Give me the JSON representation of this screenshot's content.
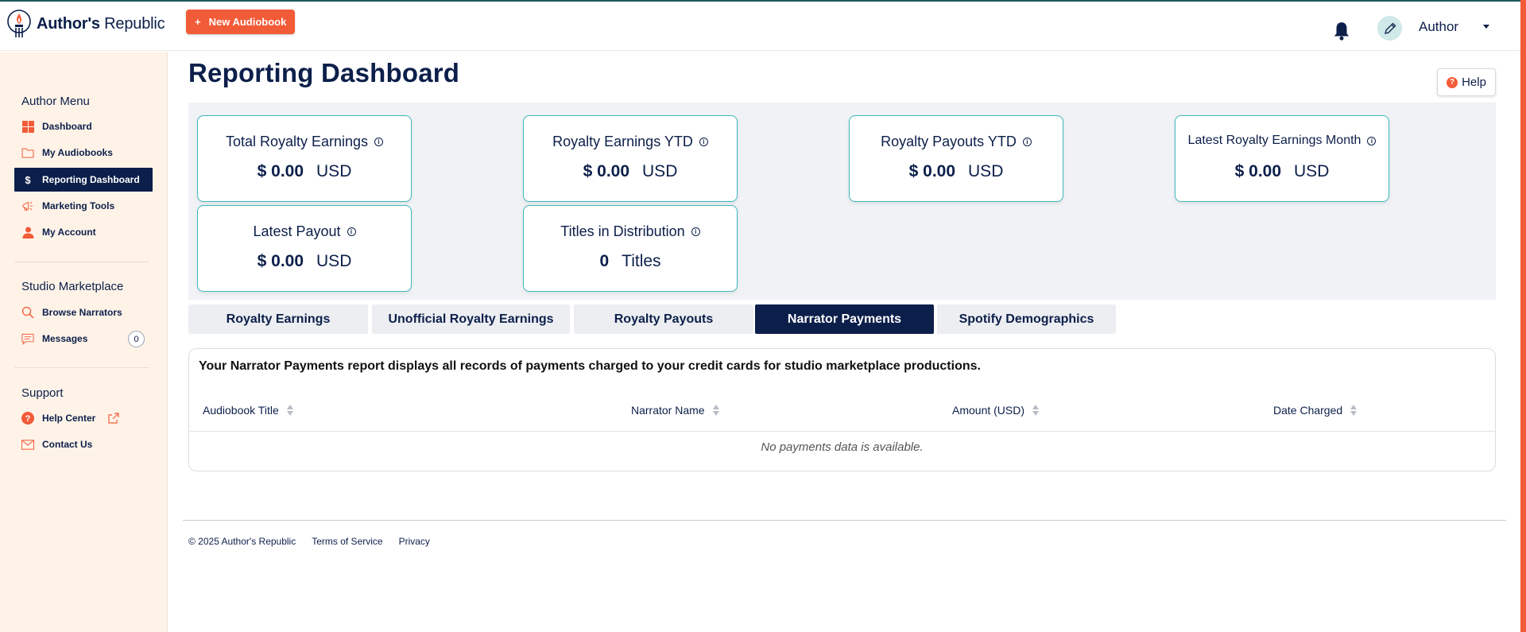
{
  "brand": {
    "name_bold": "Author's",
    "name_rest": " Republic"
  },
  "header": {
    "new_button": "New Audiobook",
    "new_button_icon": "+",
    "user_name": "Author"
  },
  "sidebar": {
    "author_menu_title": "Author Menu",
    "author_items": [
      {
        "label": "Dashboard",
        "icon": "grid-icon"
      },
      {
        "label": "My Audiobooks",
        "icon": "folder-icon"
      },
      {
        "label": "Reporting Dashboard",
        "icon": "dollar-icon"
      },
      {
        "label": "Marketing Tools",
        "icon": "megaphone-icon"
      },
      {
        "label": "My Account",
        "icon": "person-icon"
      }
    ],
    "marketplace_title": "Studio Marketplace",
    "marketplace_items": [
      {
        "label": "Browse Narrators",
        "icon": "search-icon"
      },
      {
        "label": "Messages",
        "icon": "chat-icon",
        "badge": "0"
      }
    ],
    "support_title": "Support",
    "support_items": [
      {
        "label": "Help Center",
        "icon": "question-icon"
      },
      {
        "label": "Contact Us",
        "icon": "mail-icon"
      }
    ]
  },
  "page": {
    "title": "Reporting Dashboard",
    "help_label": "Help",
    "help_icon": "?"
  },
  "stats": [
    {
      "label": "Total Royalty Earnings",
      "value": "$ 0.00",
      "unit": "USD"
    },
    {
      "label": "Royalty Earnings YTD",
      "value": "$ 0.00",
      "unit": "USD"
    },
    {
      "label": "Royalty Payouts YTD",
      "value": "$ 0.00",
      "unit": "USD"
    },
    {
      "label": "Latest Royalty Earnings Month",
      "value": "$ 0.00",
      "unit": "USD"
    },
    {
      "label": "Latest Payout",
      "value": "$ 0.00",
      "unit": "USD"
    },
    {
      "label": "Titles in Distribution",
      "value": "0",
      "unit": "Titles"
    }
  ],
  "tabs": [
    {
      "label": "Royalty Earnings",
      "active": false
    },
    {
      "label": "Unofficial Royalty Earnings",
      "active": false
    },
    {
      "label": "Royalty Payouts",
      "active": false
    },
    {
      "label": "Narrator Payments",
      "active": true
    },
    {
      "label": "Spotify Demographics",
      "active": false
    }
  ],
  "report": {
    "description": "Your Narrator Payments report displays all records of payments charged to your credit cards for studio marketplace productions.",
    "columns": [
      "Audiobook Title",
      "Narrator Name",
      "Amount (USD)",
      "Date Charged"
    ],
    "empty_message": "No payments data is available."
  },
  "footer": {
    "copyright": "© 2025 Author's Republic",
    "terms": "Terms of Service",
    "privacy": "Privacy"
  },
  "colors": {
    "navy": "#0c1f4a",
    "accent": "#f25b38",
    "teal": "#3fb8bf",
    "sidebar_bg": "#fff3e8"
  }
}
